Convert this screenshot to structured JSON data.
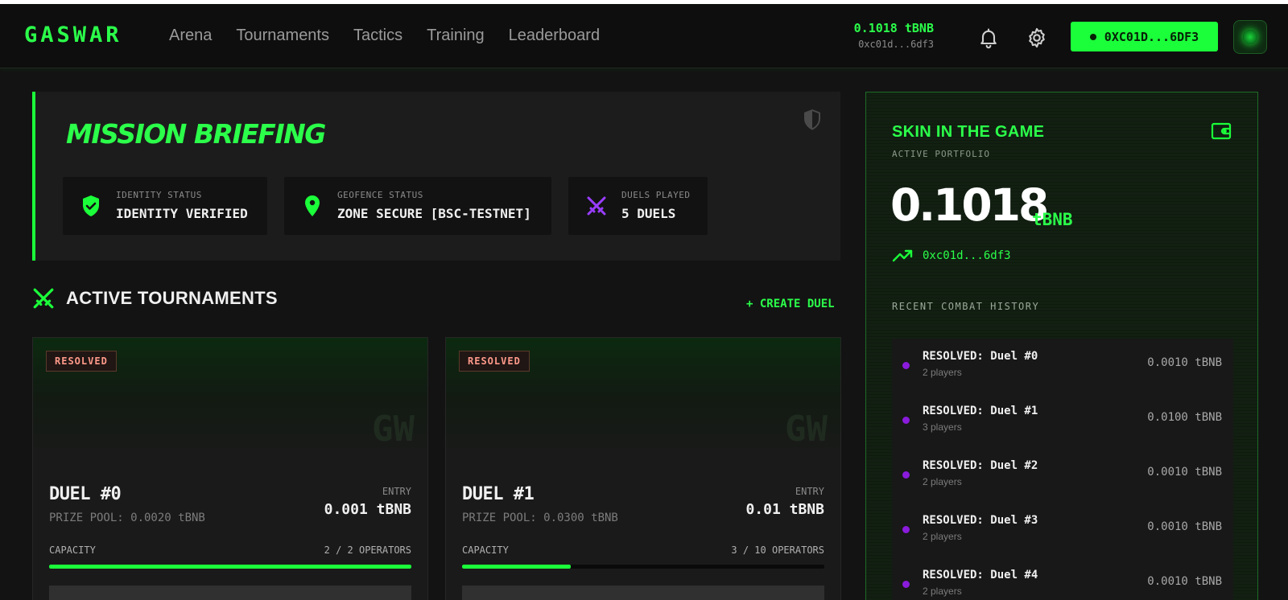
{
  "header": {
    "logo": "GASWAR",
    "nav": [
      "Arena",
      "Tournaments",
      "Tactics",
      "Training",
      "Leaderboard"
    ],
    "balance": "0.1018 tBNB",
    "address_short": "0xc01d...6df3",
    "wallet_button": "0XC01D...6DF3",
    "icons": [
      "bell-icon",
      "gear-icon"
    ]
  },
  "mission": {
    "title": "MISSION BRIEFING",
    "stats": [
      {
        "label": "IDENTITY STATUS",
        "value": "IDENTITY VERIFIED",
        "icon": "shield-check-icon"
      },
      {
        "label": "GEOFENCE STATUS",
        "value": "ZONE SECURE [BSC-TESTNET]",
        "icon": "map-pin-icon"
      },
      {
        "label": "DUELS PLAYED",
        "value": "5 DUELS",
        "icon": "crossed-swords-icon"
      }
    ]
  },
  "tournaments": {
    "title": "ACTIVE TOURNAMENTS",
    "create_label": "+ CREATE DUEL",
    "cards": [
      {
        "status": "RESOLVED",
        "watermark": "GW",
        "name": "DUEL #0",
        "prize": "PRIZE POOL: 0.0020 tBNB",
        "entry_label": "ENTRY",
        "entry": "0.001 tBNB",
        "capacity_label": "CAPACITY",
        "capacity": "2 / 2 OPERATORS",
        "fill": 1.0
      },
      {
        "status": "RESOLVED",
        "watermark": "GW",
        "name": "DUEL #1",
        "prize": "PRIZE POOL: 0.0300 tBNB",
        "entry_label": "ENTRY",
        "entry": "0.01 tBNB",
        "capacity_label": "CAPACITY",
        "capacity": "3 / 10 OPERATORS",
        "fill": 0.3
      }
    ]
  },
  "portfolio": {
    "title": "SKIN IN THE GAME",
    "subtitle": "ACTIVE PORTFOLIO",
    "balance": "0.1018",
    "unit": "tBNB",
    "address": "0xc01d...6df3",
    "history_label": "RECENT COMBAT HISTORY",
    "history": [
      {
        "title": "RESOLVED: Duel #0",
        "players": "2 players",
        "amount": "0.0010 tBNB"
      },
      {
        "title": "RESOLVED: Duel #1",
        "players": "3 players",
        "amount": "0.0100 tBNB"
      },
      {
        "title": "RESOLVED: Duel #2",
        "players": "2 players",
        "amount": "0.0010 tBNB"
      },
      {
        "title": "RESOLVED: Duel #3",
        "players": "2 players",
        "amount": "0.0010 tBNB"
      },
      {
        "title": "RESOLVED: Duel #4",
        "players": "2 players",
        "amount": "0.0010 tBNB"
      }
    ]
  },
  "colors": {
    "accent": "#1bff3a",
    "purple": "#8a1bdc",
    "resolved": "#ff9a8a"
  }
}
